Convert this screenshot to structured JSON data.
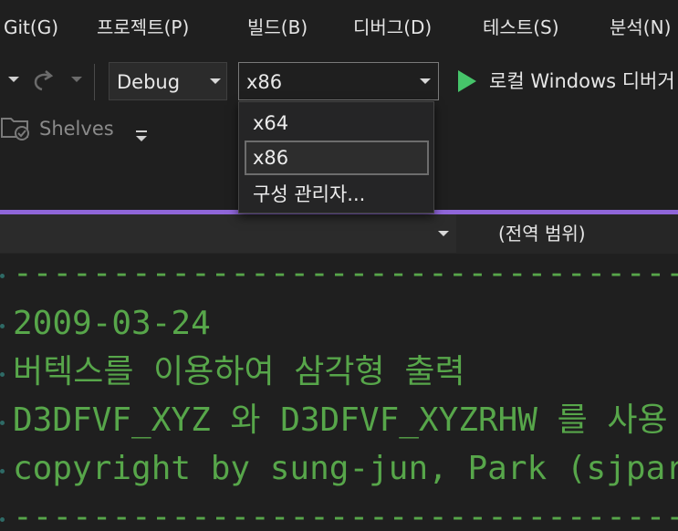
{
  "menu": {
    "items": [
      "Git(G)",
      "프로젝트(P)",
      "빌드(B)",
      "디버그(D)",
      "테스트(S)",
      "분석(N)"
    ]
  },
  "toolbar": {
    "configuration_value": "Debug",
    "platform_value": "x86",
    "run_label": "로컬 Windows 디버거"
  },
  "shelves": {
    "label": "Shelves"
  },
  "platform_dropdown": {
    "options": [
      "x64",
      "x86",
      "구성 관리자..."
    ],
    "selected": "x86"
  },
  "navigation_bar": {
    "scope_label": "(전역 범위)"
  },
  "editor": {
    "lines": [
      "-----------------------------------",
      "2009-03-24",
      "버텍스를 이용하여 삼각형 출력",
      "D3DFVF_XYZ 와 D3DFVF_XYZRHW 를 사용",
      "copyright by sung-jun, Park (sjpark",
      "-----------------------------------"
    ],
    "comment_color": "#57a64a"
  },
  "colors": {
    "accent_bar": "#8f66d9",
    "run_green": "#46c46a",
    "background": "#1f1f1f"
  }
}
